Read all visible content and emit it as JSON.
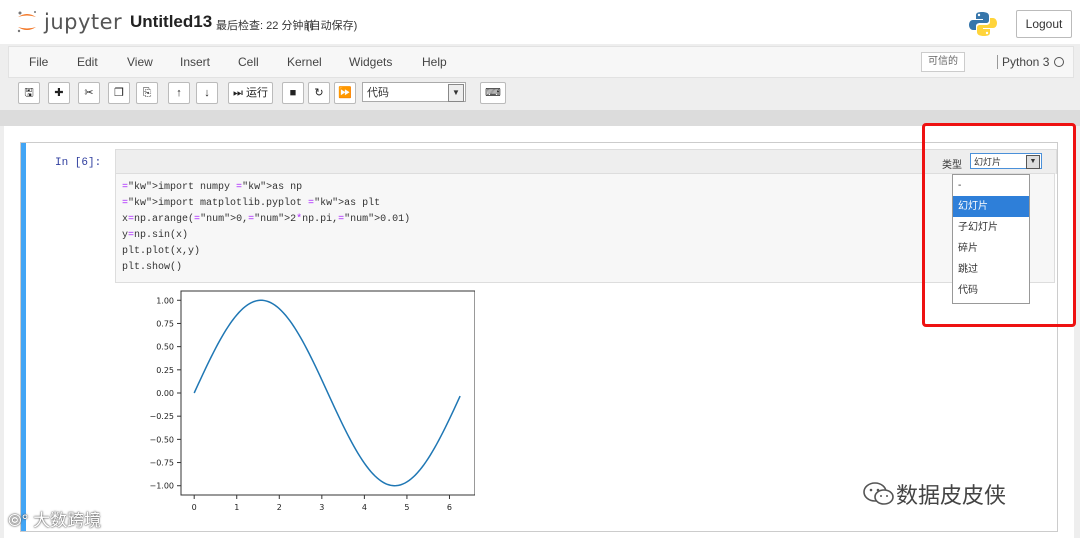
{
  "header": {
    "logo_text": "jupyter",
    "notebook_name": "Untitled13",
    "checkpoint": "最后检查: 22 分钟前",
    "autosave": "(自动保存)",
    "logout_label": "Logout"
  },
  "menubar": {
    "items": [
      "File",
      "Edit",
      "View",
      "Insert",
      "Cell",
      "Kernel",
      "Widgets",
      "Help"
    ],
    "trusted_label": "可信的",
    "kernel_name": "Python 3"
  },
  "toolbar": {
    "run_label": "运行",
    "celltype_value": "代码"
  },
  "cell": {
    "prompt": "In  [6]:",
    "celltoolbar_label": "类型",
    "celltoolbar_value": "幻灯片",
    "dropdown_options": [
      "-",
      "幻灯片",
      "子幻灯片",
      "碎片",
      "跳过",
      "代码"
    ],
    "dropdown_selected_index": 1
  },
  "code": {
    "lines": [
      "import numpy as np",
      "import matplotlib.pyplot as plt",
      "x=np.arange(0,2*np.pi,0.01)",
      "y=np.sin(x)",
      "plt.plot(x,y)",
      "plt.show()"
    ]
  },
  "chart_data": {
    "type": "line",
    "title": "",
    "xlabel": "",
    "ylabel": "",
    "xlim": [
      -0.31,
      6.6
    ],
    "ylim": [
      -1.1,
      1.1
    ],
    "x_ticks": [
      "0",
      "1",
      "2",
      "3",
      "4",
      "5",
      "6"
    ],
    "y_ticks": [
      "1.00",
      "0.75",
      "0.50",
      "0.25",
      "0.00",
      "−0.25",
      "−0.50",
      "−0.75",
      "−1.00"
    ],
    "grid": false,
    "series": [
      {
        "function": "sin(x)",
        "x_start": 0,
        "x_end": 6.28,
        "step": 0.01,
        "color": "#1f77b4"
      }
    ]
  },
  "watermarks": {
    "left": "大数跨境",
    "right": "数据皮皮侠"
  },
  "colors": {
    "accent": "#42a5f5",
    "highlight": "#ee1111",
    "selected": "#2e7fd9"
  }
}
